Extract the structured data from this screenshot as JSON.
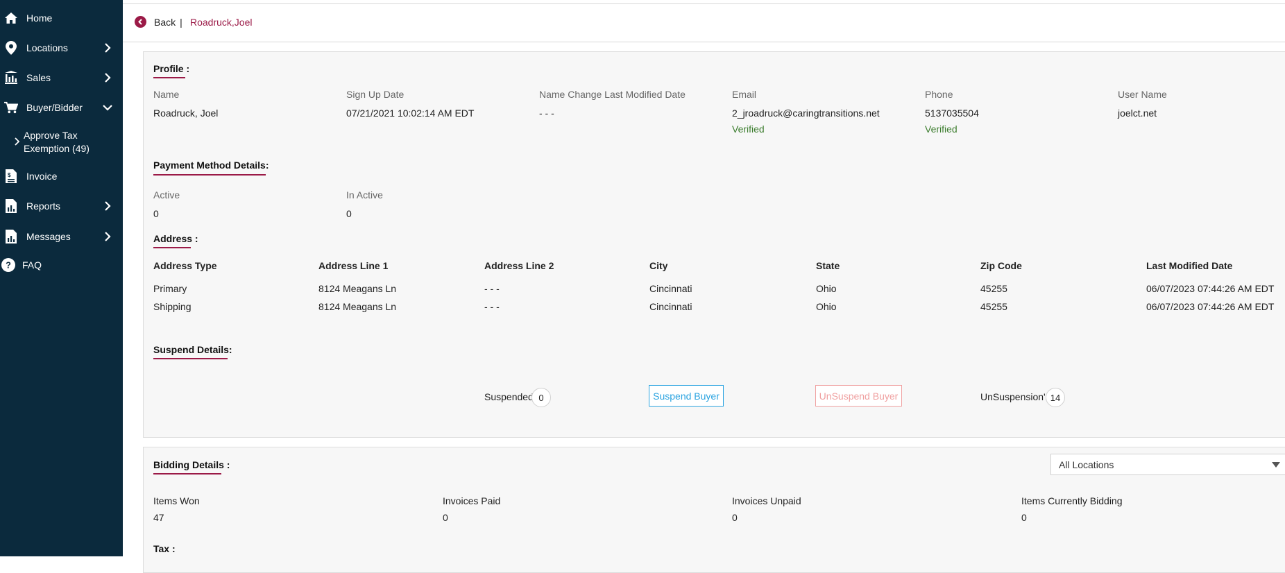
{
  "sidebar": {
    "items": [
      {
        "label": "Home",
        "icon": "home-icon"
      },
      {
        "label": "Locations",
        "icon": "location-pin-icon"
      },
      {
        "label": "Sales",
        "icon": "sales-icon"
      },
      {
        "label": "Buyer/Bidder",
        "icon": "cart-icon"
      },
      {
        "label": "Invoice",
        "icon": "invoice-icon"
      },
      {
        "label": "Reports",
        "icon": "reports-icon"
      },
      {
        "label": "Messages",
        "icon": "messages-icon"
      },
      {
        "label": "FAQ",
        "icon": "question-icon"
      }
    ],
    "subitem": {
      "line1": "Approve Tax",
      "line2": "Exemption (49)"
    }
  },
  "header": {
    "back_label": "Back",
    "separator": "|",
    "buyer_name": "Roadruck,Joel"
  },
  "profile": {
    "title": "Profile :",
    "fields": [
      {
        "label": "Name",
        "value": "Roadruck, Joel"
      },
      {
        "label": "Sign Up Date",
        "value": "07/21/2021 10:02:14 AM EDT"
      },
      {
        "label": "Name Change Last Modified Date",
        "value": "- - -"
      },
      {
        "label": "Email",
        "value": "2_jroadruck@caringtransitions.net",
        "status": "Verified"
      },
      {
        "label": "Phone",
        "value": "5137035504",
        "status": "Verified"
      },
      {
        "label": "User Name",
        "value": "joelct.net"
      }
    ]
  },
  "payment": {
    "title": "Payment Method Details:",
    "active_label": "Active",
    "active_value": "0",
    "inactive_label": "In Active",
    "inactive_value": "0"
  },
  "address": {
    "title": "Address :",
    "columns": [
      "Address Type",
      "Address Line 1",
      "Address Line 2",
      "City",
      "State",
      "Zip Code",
      "Last Modified Date"
    ],
    "rows": [
      [
        "Primary",
        "8124 Meagans Ln",
        "- - -",
        "Cincinnati",
        "Ohio",
        "45255",
        "06/07/2023 07:44:26 AM EDT"
      ],
      [
        "Shipping",
        "8124 Meagans Ln",
        "- - -",
        "Cincinnati",
        "Ohio",
        "45255",
        "06/07/2023 07:44:26 AM EDT"
      ]
    ]
  },
  "suspend": {
    "title": "Suspend Details:",
    "suspended_label": "Suspended",
    "suspended_count": "0",
    "suspend_button": "Suspend Buyer",
    "unsuspend_button": "UnSuspend Buyer",
    "unsuspensions_label": "UnSuspension's",
    "unsuspensions_count": "14"
  },
  "bidding": {
    "title": "Bidding Details :",
    "location_select": "All Locations",
    "stats": [
      {
        "label": "Items Won",
        "value": "47"
      },
      {
        "label": "Invoices Paid",
        "value": "0"
      },
      {
        "label": "Invoices Unpaid",
        "value": "0"
      },
      {
        "label": "Items Currently Bidding",
        "value": "0"
      }
    ]
  },
  "tax": {
    "title": "Tax :"
  },
  "colors": {
    "sidebar_bg": "#0b2a3d",
    "accent": "#9b1a47",
    "verified": "#3c7d2e",
    "suspend_blue": "#2aa3e0",
    "unsuspend_pink": "#f0a0a0"
  }
}
